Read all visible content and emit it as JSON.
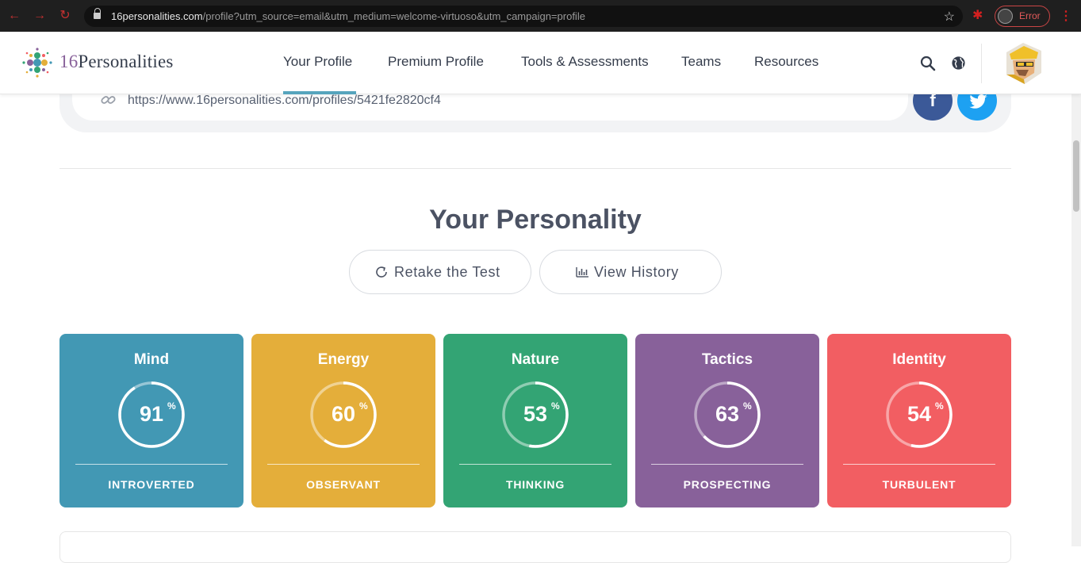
{
  "browser": {
    "url_host": "16personalities.com",
    "url_path": "/profile?utm_source=email&utm_medium=welcome-virtuoso&utm_campaign=profile",
    "profile_status": "Error"
  },
  "header": {
    "logo_num": "16",
    "logo_word": "Personalities",
    "nav": [
      "Your Profile",
      "Premium Profile",
      "Tools & Assessments",
      "Teams",
      "Resources"
    ],
    "active_nav": "Your Profile"
  },
  "share": {
    "profile_url": "https://www.16personalities.com/profiles/5421fe2820cf4"
  },
  "section": {
    "title": "Your Personality",
    "retake_label": "Retake the Test",
    "history_label": "View History"
  },
  "traits": [
    {
      "name": "Mind",
      "percent": "91",
      "value": "INTROVERTED",
      "color": "#4298b4",
      "fraction": 0.91
    },
    {
      "name": "Energy",
      "percent": "60",
      "value": "OBSERVANT",
      "color": "#e4ae3a",
      "fraction": 0.6
    },
    {
      "name": "Nature",
      "percent": "53",
      "value": "THINKING",
      "color": "#33a474",
      "fraction": 0.53
    },
    {
      "name": "Tactics",
      "percent": "63",
      "value": "PROSPECTING",
      "color": "#88619a",
      "fraction": 0.63
    },
    {
      "name": "Identity",
      "percent": "54",
      "value": "TURBULENT",
      "color": "#f25e62",
      "fraction": 0.54
    }
  ],
  "percent_sign": "%",
  "icons": {
    "lock": "lock-icon",
    "star": "star-icon",
    "extension": "puzzle-icon",
    "search": "search-icon",
    "globe": "globe-icon",
    "link": "link-icon",
    "facebook": "facebook-icon",
    "twitter": "twitter-icon",
    "retake": "refresh-icon",
    "history": "bar-chart-icon"
  }
}
